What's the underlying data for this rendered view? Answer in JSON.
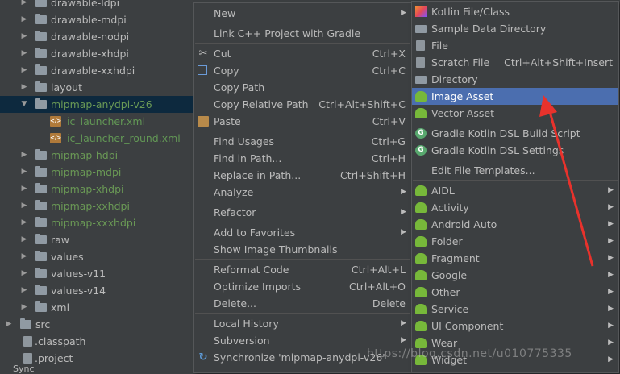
{
  "tree": {
    "items": [
      {
        "label": "drawable-ldpi",
        "style": "normal"
      },
      {
        "label": "drawable-mdpi",
        "style": "normal"
      },
      {
        "label": "drawable-nodpi",
        "style": "normal"
      },
      {
        "label": "drawable-xhdpi",
        "style": "normal"
      },
      {
        "label": "drawable-xxhdpi",
        "style": "normal"
      },
      {
        "label": "layout",
        "style": "normal"
      },
      {
        "label": "mipmap-anydpi-v26",
        "style": "green"
      },
      {
        "label": "ic_launcher.xml",
        "style": "gfile"
      },
      {
        "label": "ic_launcher_round.xml",
        "style": "gfile"
      },
      {
        "label": "mipmap-hdpi",
        "style": "green"
      },
      {
        "label": "mipmap-mdpi",
        "style": "green"
      },
      {
        "label": "mipmap-xhdpi",
        "style": "green"
      },
      {
        "label": "mipmap-xxhdpi",
        "style": "green"
      },
      {
        "label": "mipmap-xxxhdpi",
        "style": "green"
      },
      {
        "label": "raw",
        "style": "normal"
      },
      {
        "label": "values",
        "style": "normal"
      },
      {
        "label": "values-v11",
        "style": "normal"
      },
      {
        "label": "values-v14",
        "style": "normal"
      },
      {
        "label": "xml",
        "style": "normal"
      },
      {
        "label": "src",
        "style": "normal"
      },
      {
        "label": ".classpath",
        "style": "normal"
      },
      {
        "label": ".project",
        "style": "normal"
      }
    ]
  },
  "status": {
    "sync_label": "Sync"
  },
  "context_menu": {
    "items": [
      {
        "label": "New",
        "shortcut": "",
        "submenu": true
      },
      {
        "label": "Link C++ Project with Gradle",
        "shortcut": "",
        "submenu": false
      },
      {
        "label": "Cut",
        "shortcut": "Ctrl+X",
        "submenu": false,
        "icon": "scissors-icon"
      },
      {
        "label": "Copy",
        "shortcut": "Ctrl+C",
        "submenu": false,
        "icon": "copy-icon"
      },
      {
        "label": "Copy Path",
        "shortcut": "",
        "submenu": false
      },
      {
        "label": "Copy Relative Path",
        "shortcut": "Ctrl+Alt+Shift+C",
        "submenu": false
      },
      {
        "label": "Paste",
        "shortcut": "Ctrl+V",
        "submenu": false,
        "icon": "clipboard-icon"
      },
      {
        "label": "Find Usages",
        "shortcut": "Ctrl+G",
        "submenu": false
      },
      {
        "label": "Find in Path...",
        "shortcut": "Ctrl+H",
        "submenu": false
      },
      {
        "label": "Replace in Path...",
        "shortcut": "Ctrl+Shift+H",
        "submenu": false
      },
      {
        "label": "Analyze",
        "shortcut": "",
        "submenu": true
      },
      {
        "label": "Refactor",
        "shortcut": "",
        "submenu": true
      },
      {
        "label": "Add to Favorites",
        "shortcut": "",
        "submenu": true
      },
      {
        "label": "Show Image Thumbnails",
        "shortcut": "",
        "submenu": false
      },
      {
        "label": "Reformat Code",
        "shortcut": "Ctrl+Alt+L",
        "submenu": false
      },
      {
        "label": "Optimize Imports",
        "shortcut": "Ctrl+Alt+O",
        "submenu": false
      },
      {
        "label": "Delete...",
        "shortcut": "Delete",
        "submenu": false
      },
      {
        "label": "Local History",
        "shortcut": "",
        "submenu": true
      },
      {
        "label": "Subversion",
        "shortcut": "",
        "submenu": true
      },
      {
        "label": "Synchronize 'mipmap-anydpi-v26'",
        "shortcut": "",
        "submenu": false,
        "icon": "sync-icon"
      }
    ]
  },
  "new_submenu": {
    "items": [
      {
        "label": "Kotlin File/Class",
        "shortcut": "",
        "submenu": false,
        "icon": "kotlin-icon"
      },
      {
        "label": "Sample Data Directory",
        "shortcut": "",
        "submenu": false,
        "icon": "folder-icon"
      },
      {
        "label": "File",
        "shortcut": "",
        "submenu": false,
        "icon": "file-icon"
      },
      {
        "label": "Scratch File",
        "shortcut": "Ctrl+Alt+Shift+Insert",
        "submenu": false,
        "icon": "scratch-file-icon"
      },
      {
        "label": "Directory",
        "shortcut": "",
        "submenu": false,
        "icon": "folder-icon"
      },
      {
        "label": "Image Asset",
        "shortcut": "",
        "submenu": false,
        "icon": "android-icon",
        "highlighted": true
      },
      {
        "label": "Vector Asset",
        "shortcut": "",
        "submenu": false,
        "icon": "android-icon"
      },
      {
        "label": "Gradle Kotlin DSL Build Script",
        "shortcut": "",
        "submenu": false,
        "icon": "gradle-icon"
      },
      {
        "label": "Gradle Kotlin DSL Settings",
        "shortcut": "",
        "submenu": false,
        "icon": "gradle-icon"
      },
      {
        "label": "Edit File Templates...",
        "shortcut": "",
        "submenu": false
      },
      {
        "label": "AIDL",
        "shortcut": "",
        "submenu": true,
        "icon": "android-icon"
      },
      {
        "label": "Activity",
        "shortcut": "",
        "submenu": true,
        "icon": "android-icon"
      },
      {
        "label": "Android Auto",
        "shortcut": "",
        "submenu": true,
        "icon": "android-icon"
      },
      {
        "label": "Folder",
        "shortcut": "",
        "submenu": true,
        "icon": "android-icon"
      },
      {
        "label": "Fragment",
        "shortcut": "",
        "submenu": true,
        "icon": "android-icon"
      },
      {
        "label": "Google",
        "shortcut": "",
        "submenu": true,
        "icon": "android-icon"
      },
      {
        "label": "Other",
        "shortcut": "",
        "submenu": true,
        "icon": "android-icon"
      },
      {
        "label": "Service",
        "shortcut": "",
        "submenu": true,
        "icon": "android-icon"
      },
      {
        "label": "UI Component",
        "shortcut": "",
        "submenu": true,
        "icon": "android-icon"
      },
      {
        "label": "Wear",
        "shortcut": "",
        "submenu": true,
        "icon": "android-icon"
      },
      {
        "label": "Widget",
        "shortcut": "",
        "submenu": true,
        "icon": "android-icon"
      }
    ]
  },
  "watermark": "https://blog.csdn.net/u010775335",
  "colors": {
    "highlight": "#4b6eaf",
    "arrow": "#e8322c",
    "selected_row": "#0d293e",
    "green_text": "#6a9955"
  }
}
